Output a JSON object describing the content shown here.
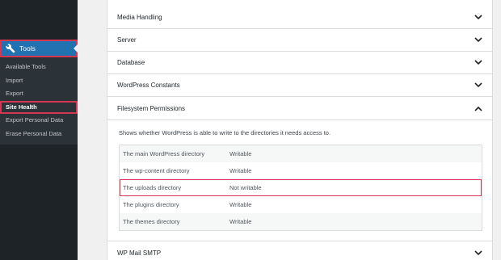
{
  "sidebar": {
    "active_menu": "Tools",
    "items": [
      {
        "label": "Available Tools"
      },
      {
        "label": "Import"
      },
      {
        "label": "Export"
      },
      {
        "label": "Site Health"
      },
      {
        "label": "Export Personal Data"
      },
      {
        "label": "Erase Personal Data"
      }
    ]
  },
  "sections": {
    "media": "Media Handling",
    "server": "Server",
    "database": "Database",
    "constants": "WordPress Constants",
    "filesystem": "Filesystem Permissions",
    "mail": "WP Mail SMTP"
  },
  "filesystem": {
    "description": "Shows whether WordPress is able to write to the directories it needs access to.",
    "rows": [
      {
        "name": "The main WordPress directory",
        "status": "Writable"
      },
      {
        "name": "The wp-content directory",
        "status": "Writable"
      },
      {
        "name": "The uploads directory",
        "status": "Not writable"
      },
      {
        "name": "The plugins directory",
        "status": "Writable"
      },
      {
        "name": "The themes directory",
        "status": "Writable"
      }
    ]
  },
  "colors": {
    "highlight": "#d63652",
    "accent": "#2271b1",
    "sidebar": "#1d2327"
  }
}
